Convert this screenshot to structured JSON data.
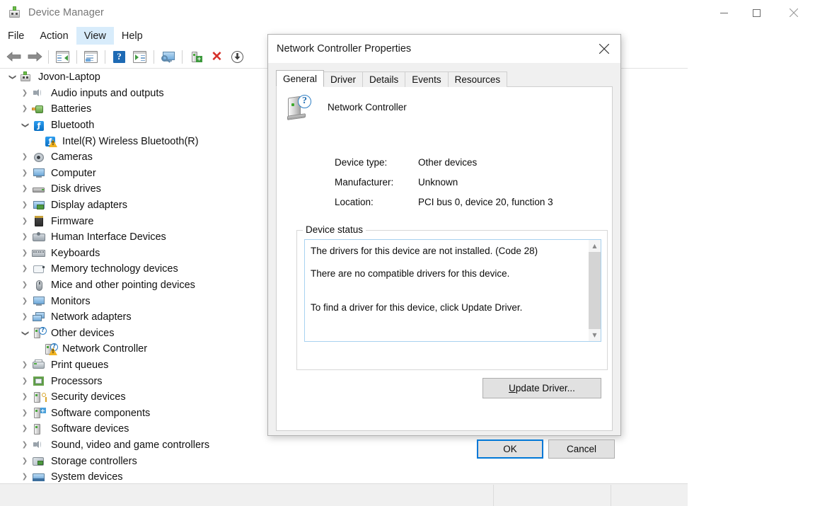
{
  "window": {
    "title": "Device Manager",
    "icon": "device-manager-icon",
    "controls": {
      "minimize": "minimize-icon",
      "maximize": "maximize-icon",
      "close": "close-icon"
    }
  },
  "menubar": {
    "items": [
      {
        "label": "File",
        "hovered": false
      },
      {
        "label": "Action",
        "hovered": false
      },
      {
        "label": "View",
        "hovered": true
      },
      {
        "label": "Help",
        "hovered": false
      }
    ]
  },
  "toolbar": {
    "buttons": [
      {
        "name": "back-icon",
        "tooltip": "Back"
      },
      {
        "name": "forward-icon",
        "tooltip": "Forward"
      },
      {
        "name": "show-hide-console-tree-icon",
        "tooltip": "Show/Hide Console Tree"
      },
      {
        "name": "properties-icon",
        "tooltip": "Properties"
      },
      {
        "name": "help-icon",
        "tooltip": "Help"
      },
      {
        "name": "update-driver-icon",
        "tooltip": "Update driver"
      },
      {
        "name": "scan-hardware-changes-icon",
        "tooltip": "Scan for hardware changes"
      },
      {
        "name": "enable-device-icon",
        "tooltip": "Enable device"
      },
      {
        "name": "uninstall-device-icon",
        "tooltip": "Uninstall device"
      },
      {
        "name": "disable-device-icon",
        "tooltip": "Disable device"
      }
    ]
  },
  "tree": {
    "items": [
      {
        "label": "Jovon-Laptop",
        "depth": 0,
        "twisty": "open",
        "icon": "computer-root-icon",
        "warning": false
      },
      {
        "label": "Audio inputs and outputs",
        "depth": 1,
        "twisty": "closed",
        "icon": "speaker-icon",
        "warning": false
      },
      {
        "label": "Batteries",
        "depth": 1,
        "twisty": "closed",
        "icon": "battery-icon",
        "warning": false
      },
      {
        "label": "Bluetooth",
        "depth": 1,
        "twisty": "open",
        "icon": "bluetooth-icon",
        "warning": false
      },
      {
        "label": "Intel(R) Wireless Bluetooth(R)",
        "depth": 2,
        "twisty": "none",
        "icon": "bluetooth-icon",
        "warning": true
      },
      {
        "label": "Cameras",
        "depth": 1,
        "twisty": "closed",
        "icon": "camera-icon",
        "warning": false
      },
      {
        "label": "Computer",
        "depth": 1,
        "twisty": "closed",
        "icon": "monitor-icon",
        "warning": false
      },
      {
        "label": "Disk drives",
        "depth": 1,
        "twisty": "closed",
        "icon": "disk-drive-icon",
        "warning": false
      },
      {
        "label": "Display adapters",
        "depth": 1,
        "twisty": "closed",
        "icon": "display-adapter-icon",
        "warning": false
      },
      {
        "label": "Firmware",
        "depth": 1,
        "twisty": "closed",
        "icon": "firmware-icon",
        "warning": false
      },
      {
        "label": "Human Interface Devices",
        "depth": 1,
        "twisty": "closed",
        "icon": "hid-icon",
        "warning": false
      },
      {
        "label": "Keyboards",
        "depth": 1,
        "twisty": "closed",
        "icon": "keyboard-icon",
        "warning": false
      },
      {
        "label": "Memory technology devices",
        "depth": 1,
        "twisty": "closed",
        "icon": "memory-icon",
        "warning": false
      },
      {
        "label": "Mice and other pointing devices",
        "depth": 1,
        "twisty": "closed",
        "icon": "mouse-icon",
        "warning": false
      },
      {
        "label": "Monitors",
        "depth": 1,
        "twisty": "closed",
        "icon": "monitor-icon",
        "warning": false
      },
      {
        "label": "Network adapters",
        "depth": 1,
        "twisty": "closed",
        "icon": "network-adapter-icon",
        "warning": false
      },
      {
        "label": "Other devices",
        "depth": 1,
        "twisty": "open",
        "icon": "unknown-device-icon",
        "warning": false
      },
      {
        "label": "Network Controller",
        "depth": 2,
        "twisty": "none",
        "icon": "unknown-device-icon",
        "warning": true
      },
      {
        "label": "Print queues",
        "depth": 1,
        "twisty": "closed",
        "icon": "printer-icon",
        "warning": false
      },
      {
        "label": "Processors",
        "depth": 1,
        "twisty": "closed",
        "icon": "processor-icon",
        "warning": false
      },
      {
        "label": "Security devices",
        "depth": 1,
        "twisty": "closed",
        "icon": "security-device-icon",
        "warning": false
      },
      {
        "label": "Software components",
        "depth": 1,
        "twisty": "closed",
        "icon": "software-component-icon",
        "warning": false
      },
      {
        "label": "Software devices",
        "depth": 1,
        "twisty": "closed",
        "icon": "software-device-icon",
        "warning": false
      },
      {
        "label": "Sound, video and game controllers",
        "depth": 1,
        "twisty": "closed",
        "icon": "speaker-icon",
        "warning": false
      },
      {
        "label": "Storage controllers",
        "depth": 1,
        "twisty": "closed",
        "icon": "storage-controller-icon",
        "warning": false
      },
      {
        "label": "System devices",
        "depth": 1,
        "twisty": "closed",
        "icon": "system-device-icon",
        "warning": false
      }
    ],
    "scrollbar": {
      "up": "chevron-up-icon",
      "down": "chevron-down-icon"
    }
  },
  "dialog": {
    "title": "Network Controller Properties",
    "close": "close-icon",
    "tabs": [
      {
        "label": "General",
        "active": true
      },
      {
        "label": "Driver",
        "active": false
      },
      {
        "label": "Details",
        "active": false
      },
      {
        "label": "Events",
        "active": false
      },
      {
        "label": "Resources",
        "active": false
      }
    ],
    "device_name": "Network Controller",
    "device_icon": "unknown-device-icon",
    "properties": [
      {
        "label": "Device type:",
        "value": "Other devices"
      },
      {
        "label": "Manufacturer:",
        "value": "Unknown"
      },
      {
        "label": "Location:",
        "value": "PCI bus 0, device 20, function 3"
      }
    ],
    "device_status": {
      "legend": "Device status",
      "lines": [
        "The drivers for this device are not installed. (Code 28)",
        "There are no compatible drivers for this device.",
        "To find a driver for this device, click Update Driver."
      ],
      "scrollbar": {
        "up": "chevron-up-icon",
        "down": "chevron-down-icon"
      }
    },
    "buttons": {
      "update_driver_prefix": "U",
      "update_driver_rest": "pdate Driver...",
      "ok": "OK",
      "cancel": "Cancel"
    }
  },
  "colors": {
    "accent": "#0078d7",
    "menu_hover": "#d8ecfb",
    "warning": "#f0b323",
    "error": "#d6312b",
    "dialog_bg": "#f0f0f0"
  }
}
